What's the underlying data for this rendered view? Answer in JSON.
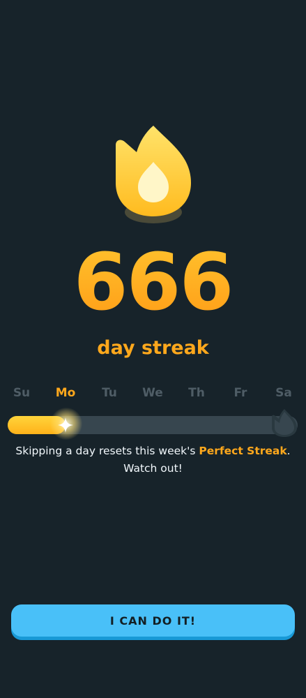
{
  "streak": {
    "count": "666",
    "label": "day streak"
  },
  "week": {
    "days": [
      {
        "abbr": "Su",
        "active": false
      },
      {
        "abbr": "Mo",
        "active": true
      },
      {
        "abbr": "Tu",
        "active": false
      },
      {
        "abbr": "We",
        "active": false
      },
      {
        "abbr": "Th",
        "active": false
      },
      {
        "abbr": "Fr",
        "active": false
      },
      {
        "abbr": "Sa",
        "active": false
      }
    ],
    "progress_fraction": 0.2
  },
  "message": {
    "prefix": "Skipping a day resets this week's ",
    "highlight": "Perfect Streak",
    "suffix": ". Watch out!"
  },
  "cta": {
    "label": "I CAN DO IT!"
  },
  "colors": {
    "background": "#17232a",
    "accent_orange": "#ffa81c",
    "button_blue": "#49c0f8",
    "track": "#37464f"
  },
  "icons": [
    "flame-icon",
    "sparkle-icon",
    "flame-outline-icon"
  ]
}
